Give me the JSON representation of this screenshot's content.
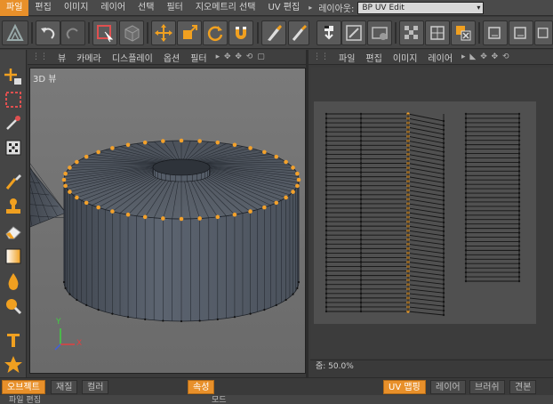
{
  "menubar": {
    "items": [
      "파일",
      "편집",
      "이미지",
      "레이어",
      "선택",
      "필터",
      "지오메트리 선택",
      "UV 편집"
    ],
    "layout_label": "레이아웃:",
    "layout_value": "BP UV Edit"
  },
  "viewport": {
    "menu": [
      "뷰",
      "카메라",
      "디스플레이",
      "옵션",
      "필터"
    ],
    "label": "3D 뷰",
    "axis_y": "Y",
    "axis_x": "X"
  },
  "uv": {
    "menu": [
      "파일",
      "편집",
      "이미지",
      "레이어"
    ],
    "zoom": "줌: 50.0%"
  },
  "bottom": {
    "tabs_left": [
      "오브젝트",
      "재질",
      "컬러"
    ],
    "tab_attr": "속성",
    "tabs_right": [
      "UV 맵핑",
      "레이어",
      "브러쉬",
      "견본"
    ],
    "strip_left": "파일 편집",
    "strip_right": "모드"
  },
  "colors": {
    "accent": "#e8902a",
    "bg": "#3a3a3a",
    "mesh": "#525a66"
  }
}
